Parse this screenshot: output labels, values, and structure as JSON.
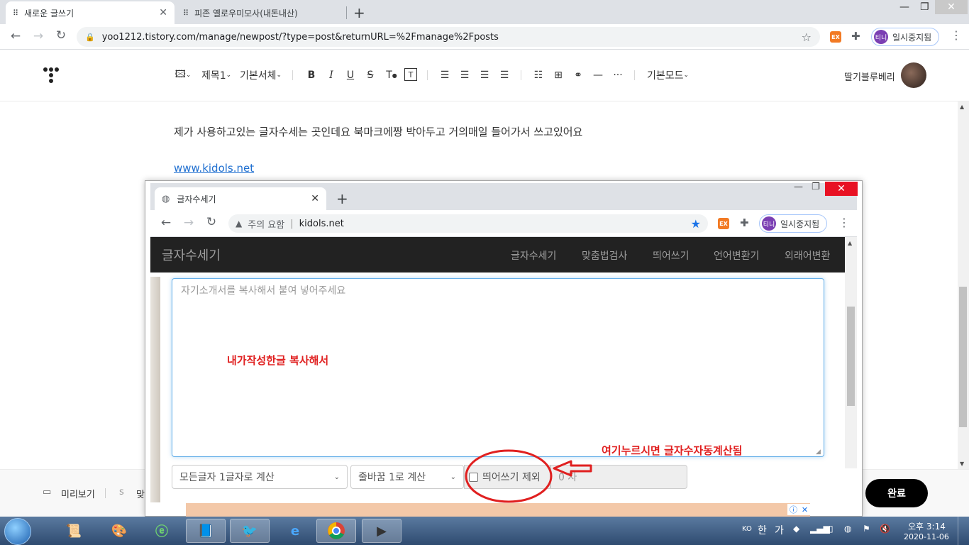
{
  "browser": {
    "tabs": [
      {
        "label": "새로운 글쓰기",
        "active": true
      },
      {
        "label": "피존 옐로우미모사(내돈내산)",
        "active": false
      }
    ],
    "url": "yoo1212.tistory.com/manage/newpost/?type=post&returnURL=%2Fmanage%2Fposts",
    "ext_badge": "EX",
    "profile_avatar": "티니",
    "profile_label": "일시중지됨"
  },
  "editor": {
    "toolbar": {
      "heading": "제목1",
      "font": "기본서체",
      "mode": "기본모드"
    },
    "username": "딸기블루베리",
    "body_text": "제가 사용하고있는 글자수세는 곳인데요 북마크에짱 박아두고 거의매일 들어가서 쓰고있어요",
    "link_text": "www.kidols.net",
    "bottom": {
      "preview_label": "미리보기",
      "partial_label": "맞",
      "done_label": "완료"
    }
  },
  "inner": {
    "tab_label": "글자수세기",
    "warning_label": "주의 요함",
    "url": "kidols.net",
    "ext_badge": "EX",
    "profile_avatar": "티니",
    "profile_label": "일시중지됨",
    "site": {
      "brand": "글자수세기",
      "nav": [
        "글자수세기",
        "맞춤법검사",
        "띄어쓰기",
        "언어변환기",
        "외래어변환"
      ]
    },
    "textarea_placeholder": "자기소개서를 복사해서 붙여 넣어주세요",
    "select1": "모든글자 1글자로 계산",
    "select2": "줄바꿈 1로 계산",
    "checkbox_label": "띄어쓰기 제외",
    "count_value": "0 자"
  },
  "annotations": {
    "paste_note": "내가작성한글 복사해서",
    "click_note": "여기누르시면 글자수자동계산됨"
  },
  "taskbar": {
    "lang": "KO",
    "ime1": "한",
    "ime2": "가",
    "time": "오후 3:14",
    "date": "2020-11-06"
  },
  "colors": {
    "annotation": "#e02020",
    "accent_blue": "#1a73e8",
    "close_red": "#e81123"
  }
}
